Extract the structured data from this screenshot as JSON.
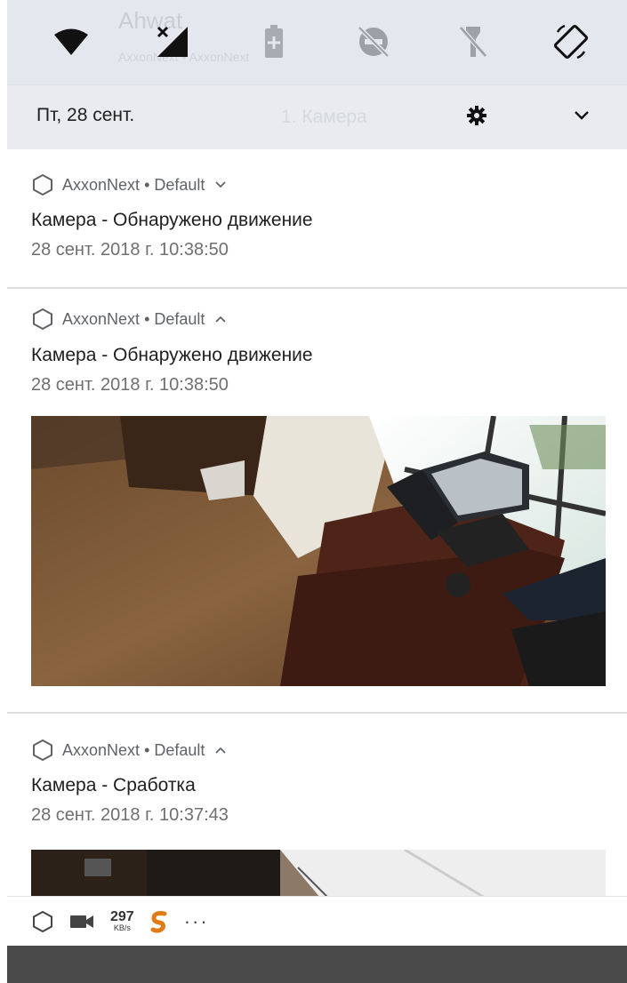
{
  "quick_settings": {
    "background_app_title": "Ahwat",
    "background_app_subtitle": "AxxonNext • AxxonNext",
    "date": "Пт, 28 сент.",
    "background_camera_label": "1. Камера",
    "icons": [
      "wifi-icon",
      "no-signal-icon",
      "battery-saver-icon",
      "do-not-disturb-icon",
      "flashlight-off-icon",
      "auto-rotate-icon"
    ]
  },
  "notifications": [
    {
      "app": "AxxonNext",
      "channel": "Default",
      "expanded": false,
      "title": "Камера - Обнаружено движение",
      "time": "28 сент. 2018 г. 10:38:50"
    },
    {
      "app": "AxxonNext",
      "channel": "Default",
      "expanded": true,
      "title": "Камера - Обнаружено движение",
      "time": "28 сент. 2018 г. 10:38:50"
    },
    {
      "app": "AxxonNext",
      "channel": "Default",
      "expanded": true,
      "title": "Камера - Сработка",
      "time": "28 сент. 2018 г. 10:37:43"
    }
  ],
  "separator": "•",
  "bottom_bar": {
    "speed_value": "297",
    "speed_unit": "KB/s",
    "more": "···"
  },
  "colors": {
    "qs_background": "#e4e8ee",
    "accent_orange": "#e07b18",
    "navbar": "#4a4a4a"
  }
}
